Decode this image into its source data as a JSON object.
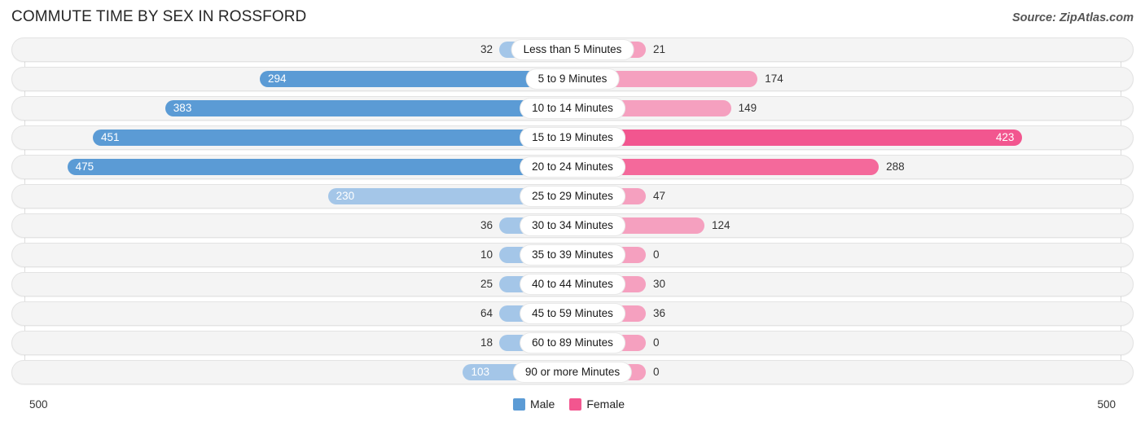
{
  "header": {
    "title": "COMMUTE TIME BY SEX IN ROSSFORD",
    "source": "Source: ZipAtlas.com"
  },
  "axis": {
    "min_label": "500",
    "max_label": "500"
  },
  "legend": {
    "items": [
      {
        "label": "Male",
        "color": "#5b9bd5"
      },
      {
        "label": "Female",
        "color": "#f2568f"
      }
    ]
  },
  "colors": {
    "male_strong": "#5b9bd5",
    "male_light": "#a4c6e8",
    "female_strong": "#f2568f",
    "female_light": "#f5a0bf",
    "track": "#f4f4f4",
    "gridline": "#dddddd"
  },
  "chart_data": {
    "type": "bar",
    "subtype": "diverging-bidirectional-bar",
    "title": "COMMUTE TIME BY SEX IN ROSSFORD",
    "xlabel": "",
    "ylabel": "",
    "axis_max": 500,
    "xlim": [
      -500,
      500
    ],
    "grid": true,
    "legend_position": "bottom-center",
    "categories": [
      "Less than 5 Minutes",
      "5 to 9 Minutes",
      "10 to 14 Minutes",
      "15 to 19 Minutes",
      "20 to 24 Minutes",
      "25 to 29 Minutes",
      "30 to 34 Minutes",
      "35 to 39 Minutes",
      "40 to 44 Minutes",
      "45 to 59 Minutes",
      "60 to 89 Minutes",
      "90 or more Minutes"
    ],
    "series": [
      {
        "name": "Male",
        "side": "left",
        "values": [
          32,
          294,
          383,
          451,
          475,
          230,
          36,
          10,
          25,
          64,
          18,
          103
        ]
      },
      {
        "name": "Female",
        "side": "right",
        "values": [
          21,
          174,
          149,
          423,
          288,
          47,
          124,
          0,
          30,
          36,
          0,
          0
        ]
      }
    ]
  }
}
